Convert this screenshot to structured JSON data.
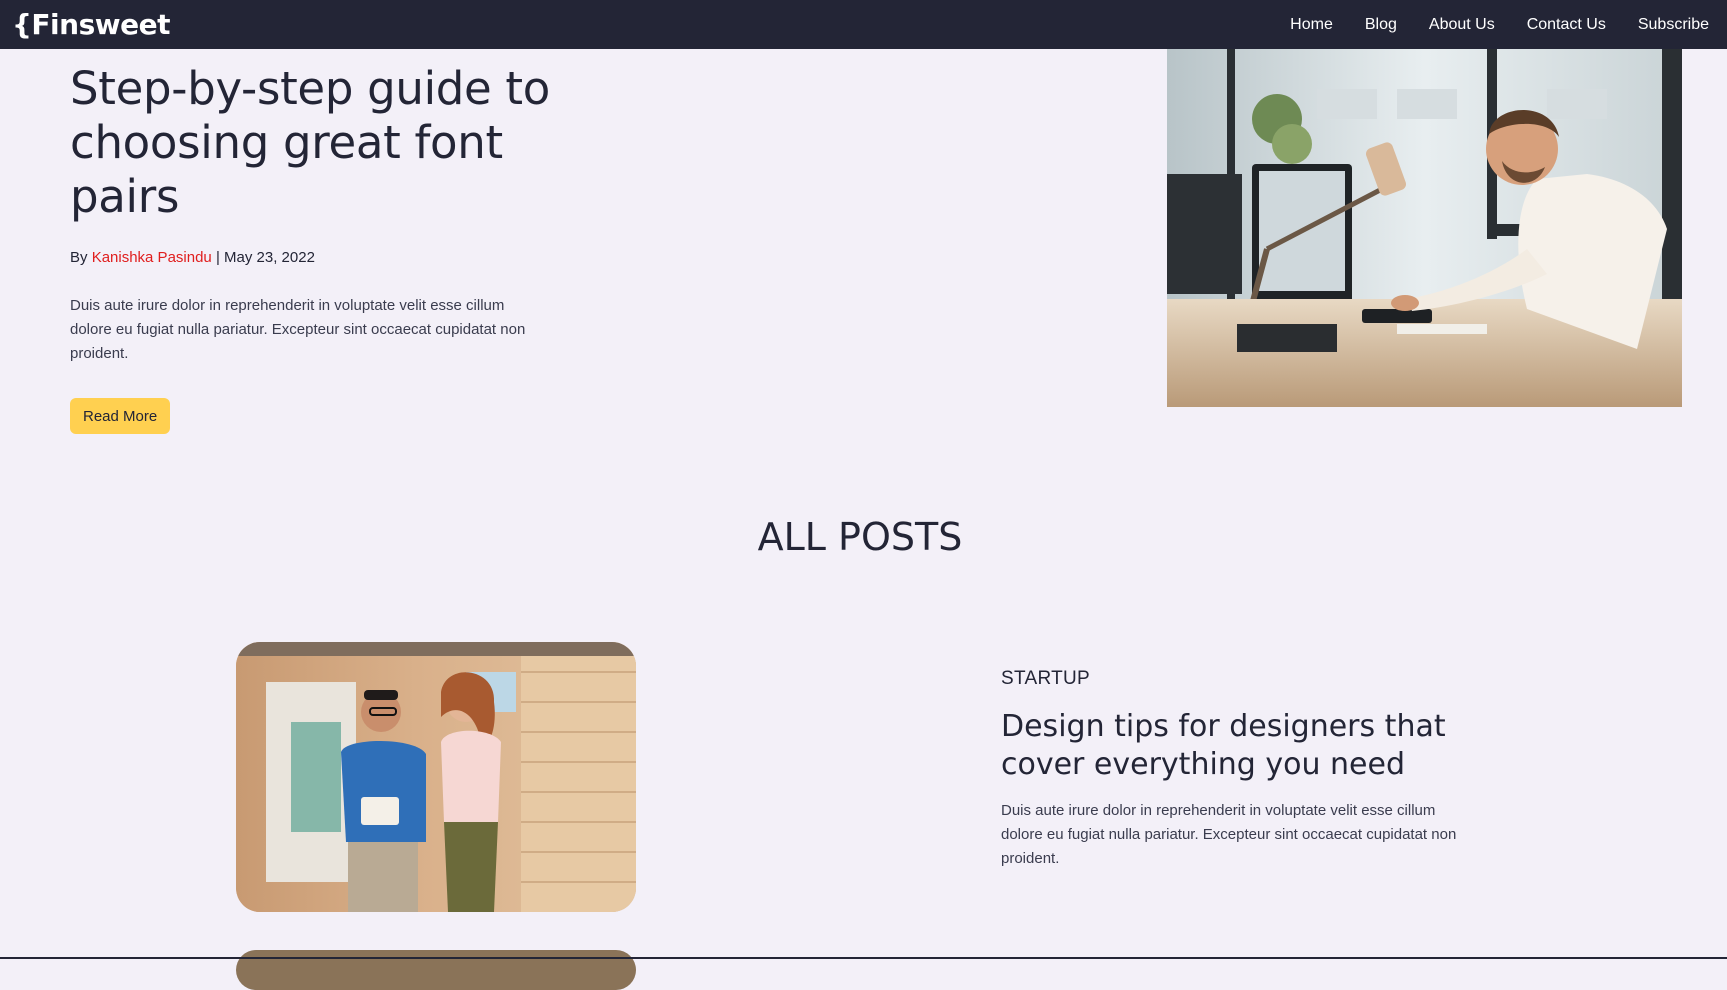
{
  "nav": {
    "logo": "{Finsweet",
    "links": [
      "Home",
      "Blog",
      "About Us",
      "Contact Us",
      "Subscribe"
    ]
  },
  "hero": {
    "title": "Step-by-step guide to choosing great font pairs",
    "by_label": "By ",
    "author": "Kanishka Pasindu",
    "separator": " | ",
    "date": "May 23, 2022",
    "excerpt": "Duis aute irure dolor in reprehenderit in voluptate velit esse cillum dolore eu fugiat nulla pariatur. Excepteur sint occaecat cupidatat non proident.",
    "button": "Read More"
  },
  "posts_section": {
    "title": "ALL POSTS",
    "posts": [
      {
        "category": "STARTUP",
        "title": "Design tips for designers that cover everything you need",
        "excerpt": "Duis aute irure dolor in reprehenderit in voluptate velit esse cillum dolore eu fugiat nulla pariatur. Excepteur sint occaecat cupidatat non proident."
      }
    ]
  },
  "colors": {
    "navbar": "#232536",
    "accent_button": "#ffd050",
    "author_link": "#e01e1e",
    "page_background": "#f3f0f8"
  }
}
